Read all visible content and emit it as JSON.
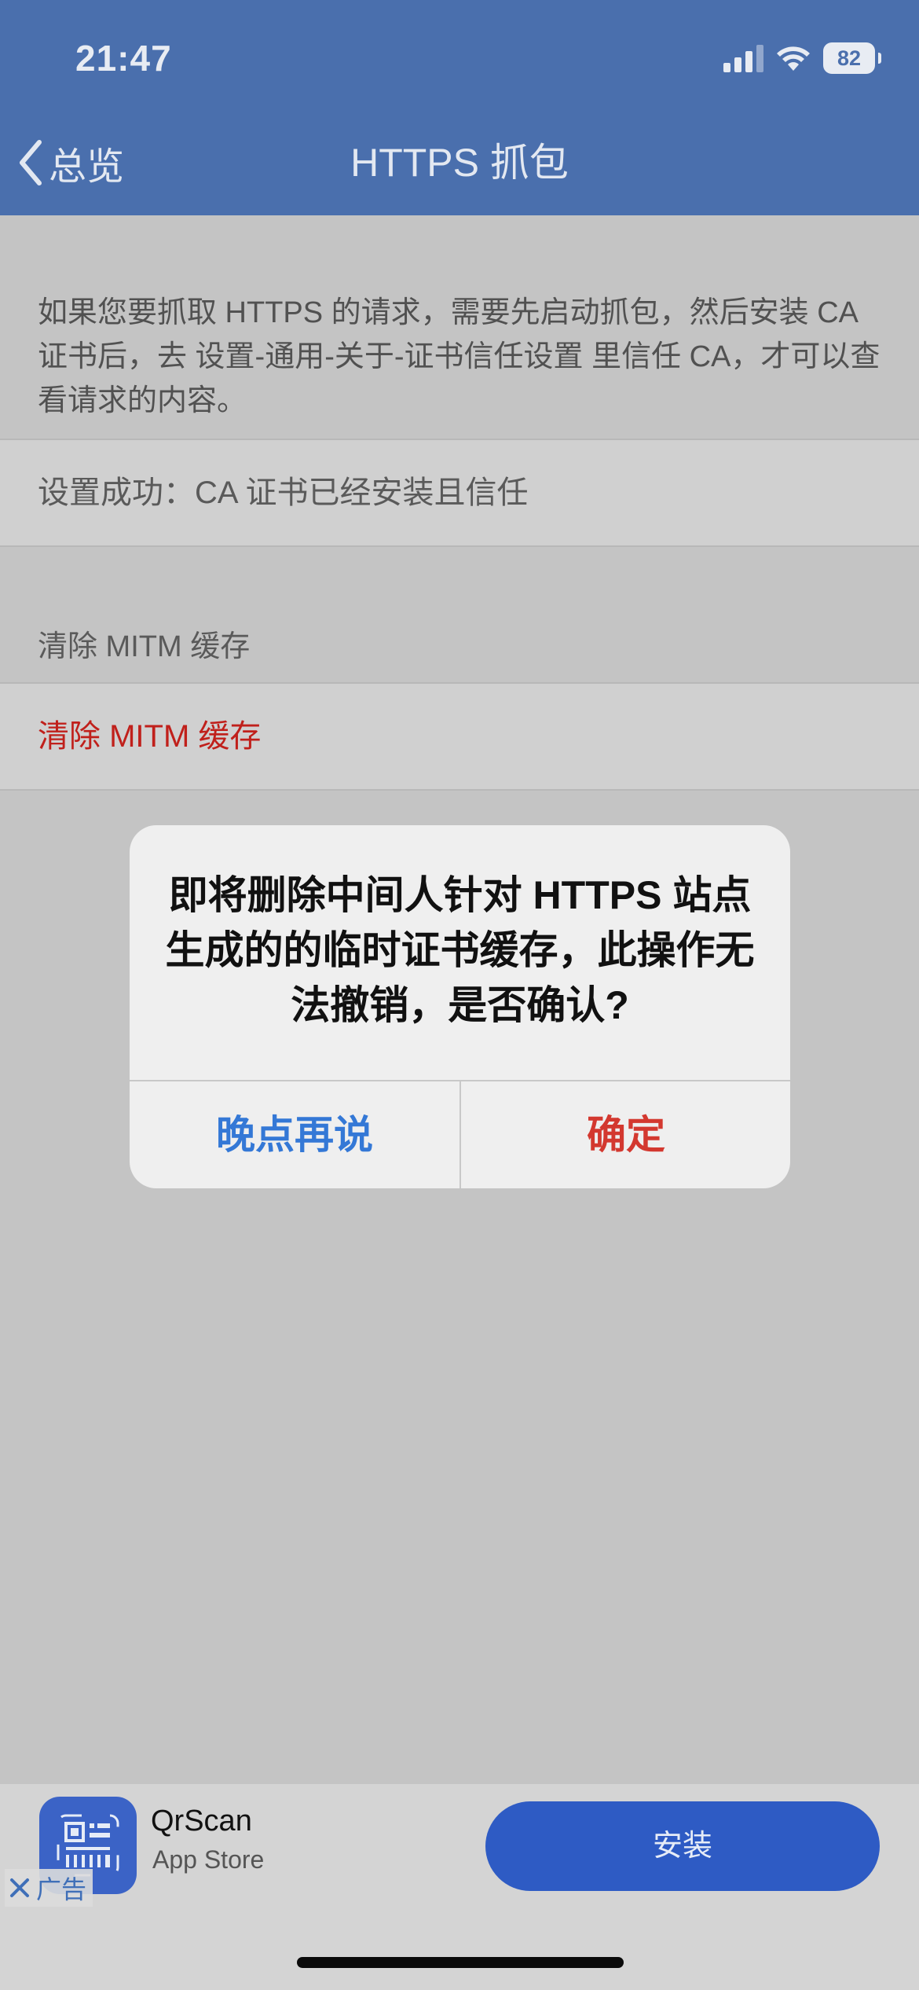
{
  "status_bar": {
    "time": "21:47",
    "battery": "82",
    "icons": [
      "cellular-signal-icon",
      "wifi-icon",
      "battery-icon"
    ]
  },
  "nav": {
    "back_label": "总览",
    "title": "HTTPS 抓包"
  },
  "content": {
    "description": "如果您要抓取 HTTPS 的请求，需要先启动抓包，然后安装 CA 证书后，去 设置-通用-关于-证书信任设置 里信任 CA，才可以查看请求的内容。",
    "ca_status": "设置成功：CA 证书已经安装且信任",
    "section_header": "清除 MITM 缓存",
    "clear_cache_action": "清除 MITM 缓存"
  },
  "alert": {
    "message": "即将删除中间人针对 HTTPS 站点生成的的临时证书缓存，此操作无法撤销，是否确认?",
    "cancel_label": "晚点再说",
    "confirm_label": "确定"
  },
  "ad": {
    "app_name": "QrScan",
    "store": "App Store",
    "label": "广告",
    "install_label": "安装"
  },
  "colors": {
    "nav_bar": "#4a6fad",
    "destructive": "#d3382f",
    "link_blue": "#3478d6",
    "install_button": "#2e5bc4"
  }
}
